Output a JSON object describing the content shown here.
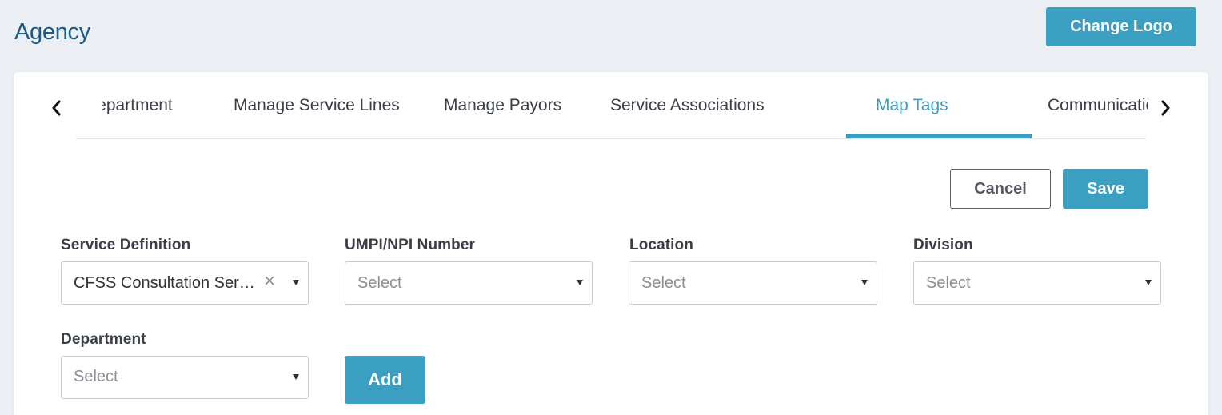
{
  "header": {
    "title": "Agency",
    "change_logo_label": "Change Logo"
  },
  "tabs": [
    {
      "label": "Department",
      "active": false
    },
    {
      "label": "Manage Service Lines",
      "active": false
    },
    {
      "label": "Manage Payors",
      "active": false
    },
    {
      "label": "Service Associations",
      "active": false
    },
    {
      "label": "Map Tags",
      "active": true
    },
    {
      "label": "Communicatio",
      "active": false
    }
  ],
  "actions": {
    "cancel_label": "Cancel",
    "save_label": "Save",
    "add_label": "Add"
  },
  "fields": {
    "service_definition": {
      "label": "Service Definition",
      "value": "CFSS Consultation Ser…"
    },
    "umpi_npi": {
      "label": "UMPI/NPI Number",
      "placeholder": "Select"
    },
    "location": {
      "label": "Location",
      "placeholder": "Select"
    },
    "division": {
      "label": "Division",
      "placeholder": "Select"
    },
    "department": {
      "label": "Department",
      "placeholder": "Select"
    }
  },
  "colors": {
    "accent": "#3a9fc0",
    "title": "#1c5a86",
    "background": "#eceff4"
  }
}
